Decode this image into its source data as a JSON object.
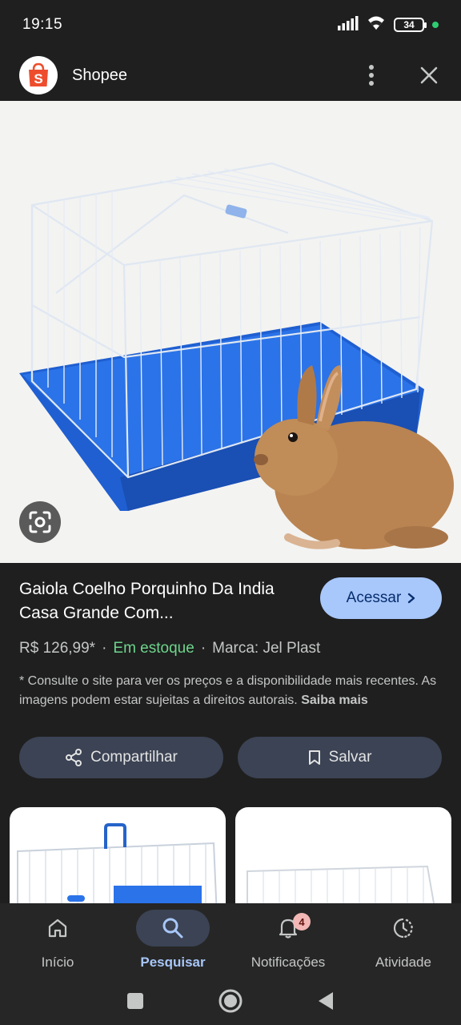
{
  "status_bar": {
    "time": "19:15",
    "battery": "34"
  },
  "app": {
    "title": "Shopee",
    "logo_letter": "S",
    "brand_color": "#ee4d2d"
  },
  "product": {
    "title": "Gaiola Coelho Porquinho Da India Casa Grande Com...",
    "access_label": "Acessar",
    "price": "R$ 126,99*",
    "stock": "Em estoque",
    "brand": "Marca: Jel Plast",
    "disclaimer": "* Consulte o site para ver os preços e a disponibilidade mais recentes. As imagens podem estar sujeitas a direitos autorais.",
    "more_link": "Saiba mais"
  },
  "actions": {
    "share_label": "Compartilhar",
    "save_label": "Salvar"
  },
  "bottom_nav": {
    "items": [
      {
        "label": "Início",
        "icon": "home-icon"
      },
      {
        "label": "Pesquisar",
        "icon": "search-icon"
      },
      {
        "label": "Notificações",
        "icon": "bell-icon",
        "badge": "4"
      },
      {
        "label": "Atividade",
        "icon": "activity-icon"
      }
    ],
    "active_index": 1
  },
  "colors": {
    "accent": "#a8c7fa",
    "stock_green": "#6dd58c",
    "button_bg": "#3b4354",
    "cage_tray": "#1f5fd1"
  }
}
